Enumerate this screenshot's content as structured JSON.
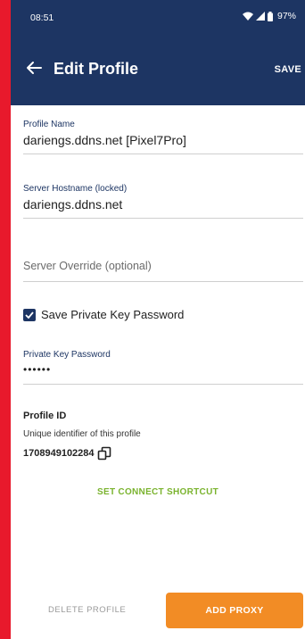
{
  "status_bar": {
    "time": "08:51",
    "battery": "97%"
  },
  "app_bar": {
    "title": "Edit Profile",
    "save_label": "SAVE"
  },
  "fields": {
    "profile_name": {
      "label": "Profile Name",
      "value": "dariengs.ddns.net [Pixel7Pro]"
    },
    "server_hostname": {
      "label": "Server Hostname (locked)",
      "value": "dariengs.ddns.net"
    },
    "server_override": {
      "placeholder": "Server Override (optional)"
    },
    "private_key_password": {
      "label": "Private Key Password",
      "value": "••••••"
    }
  },
  "checkbox": {
    "label": "Save Private Key Password",
    "checked": true
  },
  "profile_id": {
    "title": "Profile ID",
    "description": "Unique identifier of this profile",
    "value": "1708949102284"
  },
  "actions": {
    "set_shortcut": "SET CONNECT SHORTCUT",
    "delete_profile": "DELETE PROFILE",
    "add_proxy": "ADD PROXY"
  },
  "colors": {
    "appbar": "#1d3563",
    "accent_green": "#7ab32e",
    "accent_orange": "#f28c25",
    "border_red": "#e8192c"
  }
}
